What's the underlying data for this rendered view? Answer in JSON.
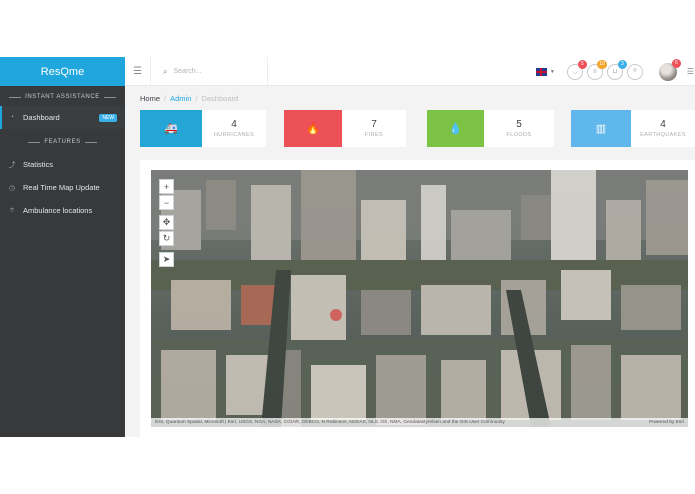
{
  "brand": {
    "name": "ResQme"
  },
  "sidebar": {
    "section_assist": "INSTANT ASSISTANCE",
    "dashboard_label": "Dashboard",
    "new_badge": "NEW",
    "section_features": "FEATURES",
    "items": [
      {
        "label": "Statistics",
        "icon": "trend-icon"
      },
      {
        "label": "Real Time Map Update",
        "icon": "clock-icon"
      },
      {
        "label": "Ambulance locations",
        "icon": "pin-icon"
      }
    ]
  },
  "topbar": {
    "search_placeholder": "Search...",
    "language_flag": "uk-flag",
    "notifications": [
      {
        "icon": "user-icon",
        "count": "5",
        "color": "#ef4f58"
      },
      {
        "icon": "list-icon",
        "count": "10",
        "color": "#f4a62a"
      },
      {
        "icon": "bag-icon",
        "count": "3",
        "color": "#3ab0e6"
      },
      {
        "icon": "map-marker-icon",
        "count": "",
        "color": ""
      }
    ],
    "avatar_count": "6"
  },
  "breadcrumb": {
    "home": "Home",
    "admin": "Admin",
    "current": "Dashboard"
  },
  "stats": [
    {
      "value": "4",
      "label": "HURRICANES",
      "color": "#23a6d5",
      "icon": "ambulance-icon"
    },
    {
      "value": "7",
      "label": "FIRES",
      "color": "#ed5158",
      "icon": "fire-icon"
    },
    {
      "value": "5",
      "label": "FLOODS",
      "color": "#7cc244",
      "icon": "water-drop-icon"
    },
    {
      "value": "4",
      "label": "EARTHQUAKES",
      "color": "#5fb7eb",
      "icon": "building-icon"
    }
  ],
  "map": {
    "attribution": "Esri, Quantum Spatial, Microsoft | Esri, USGS, NGA, NASA, CGIAR, GEBCO, N Robinson, NCEAS, NLS, OS, NMA, Geodatastyrelsen and the GIS User Community",
    "powered_by": "Powered by Esri"
  }
}
